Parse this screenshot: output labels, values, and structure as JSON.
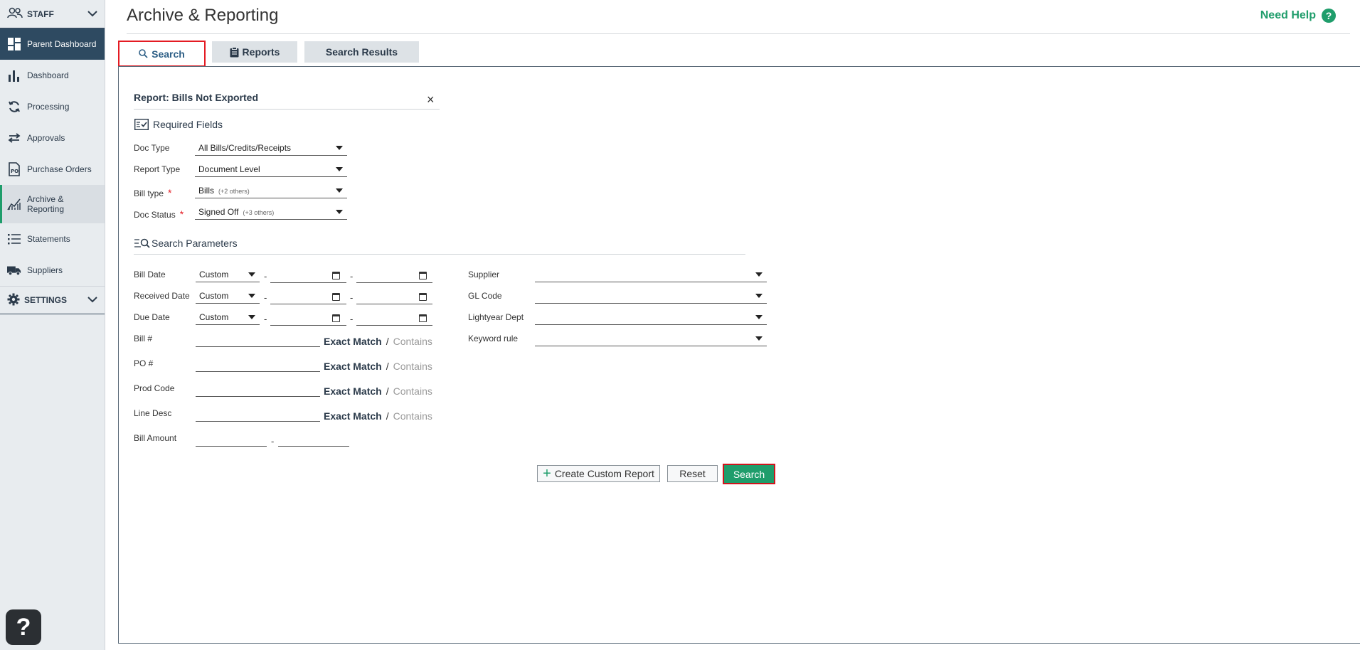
{
  "sidebar": {
    "staff_label": "STAFF",
    "settings_label": "SETTINGS",
    "items": [
      {
        "label": "Parent Dashboard"
      },
      {
        "label": "Dashboard"
      },
      {
        "label": "Processing"
      },
      {
        "label": "Approvals"
      },
      {
        "label": "Purchase Orders"
      },
      {
        "label": "Archive & Reporting"
      },
      {
        "label": "Statements"
      },
      {
        "label": "Suppliers"
      }
    ],
    "archive_line1": "Archive &",
    "archive_line2": "Reporting",
    "help_fab": "?"
  },
  "header": {
    "title": "Archive & Reporting",
    "need_help": "Need Help",
    "need_help_icon": "?"
  },
  "tabs": [
    {
      "label": "Search",
      "active": true
    },
    {
      "label": "Reports"
    },
    {
      "label": "Search Results"
    }
  ],
  "report": {
    "title": "Report: Bills Not Exported",
    "close": "×"
  },
  "required": {
    "heading": "Required Fields",
    "fields": [
      {
        "label": "Doc Type",
        "value": "All Bills/Credits/Receipts",
        "extra": "",
        "required": false
      },
      {
        "label": "Report Type",
        "value": "Document Level",
        "extra": "",
        "required": false
      },
      {
        "label": "Bill type",
        "value": "Bills",
        "extra": "(+2 others)",
        "required": true
      },
      {
        "label": "Doc Status",
        "value": "Signed Off",
        "extra": "(+3 others)",
        "required": true
      }
    ],
    "required_marker": "*"
  },
  "params": {
    "heading": "Search Parameters",
    "dates": [
      {
        "label": "Bill Date",
        "value": "Custom"
      },
      {
        "label": "Received Date",
        "value": "Custom"
      },
      {
        "label": "Due Date",
        "value": "Custom"
      }
    ],
    "texts": [
      {
        "label": "Bill #"
      },
      {
        "label": "PO #"
      },
      {
        "label": "Prod Code"
      },
      {
        "label": "Line Desc"
      }
    ],
    "exact_match": "Exact Match",
    "slash": "/",
    "contains": "Contains",
    "bill_amount": "Bill Amount",
    "dash": "-",
    "right": [
      {
        "label": "Supplier",
        "value": ""
      },
      {
        "label": "GL Code",
        "value": ""
      },
      {
        "label": "Lightyear Dept",
        "value": ""
      },
      {
        "label": "Keyword rule",
        "value": ""
      }
    ]
  },
  "actions": {
    "create_label": "Create Custom Report",
    "create_icon": "+",
    "reset_label": "Reset",
    "search_label": "Search"
  },
  "colors": {
    "accent_green": "#1f9d6b",
    "nav_dark": "#2e4a61",
    "highlight_red": "#e41b23"
  }
}
